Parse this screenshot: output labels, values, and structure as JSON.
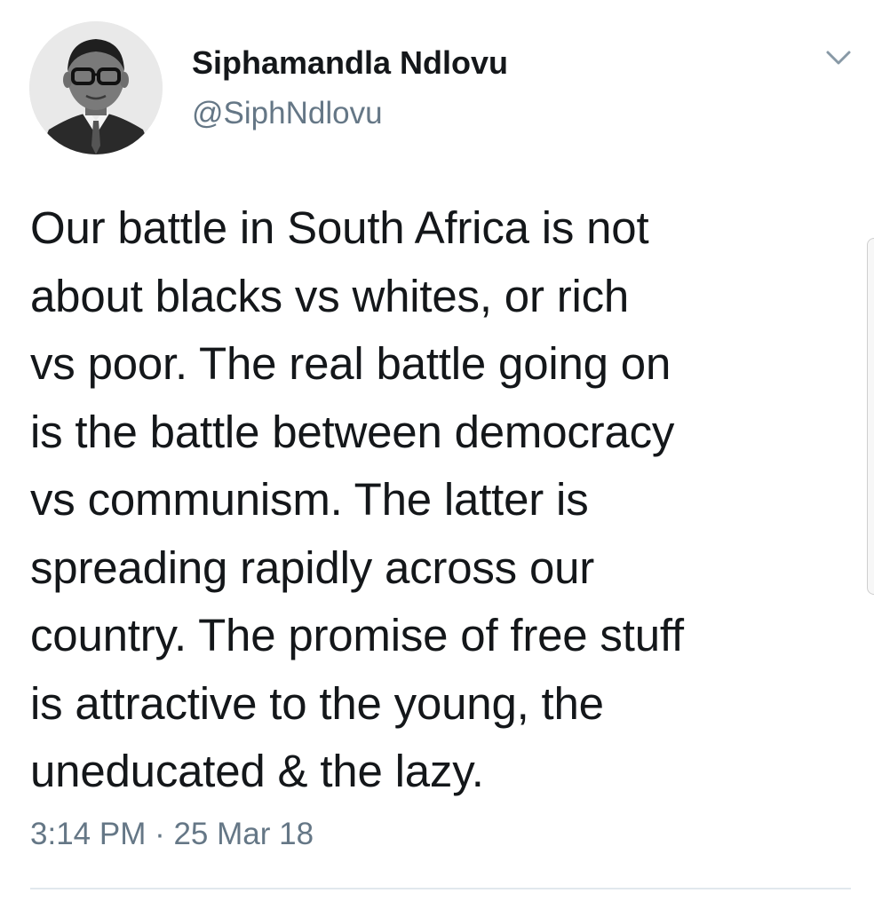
{
  "tweet": {
    "author": {
      "display_name": "Siphamandla Ndlovu",
      "handle": "@SiphNdlovu",
      "avatar_icon": "profile-photo"
    },
    "menu_icon": "chevron-down-icon",
    "text_lines": [
      "Our battle in South Africa is not",
      "about blacks vs whites, or rich",
      "vs poor. The real battle going on",
      "is the battle between democracy",
      "vs communism. The latter is",
      "spreading rapidly across our",
      "country. The promise of free stuff",
      "is attractive to the young, the",
      "uneducated & the lazy."
    ],
    "time": "3:14 PM",
    "separator": " · ",
    "date": "25 Mar 18"
  },
  "colors": {
    "text": "#14171a",
    "secondary": "#657786",
    "divider": "#e1e8ed"
  }
}
